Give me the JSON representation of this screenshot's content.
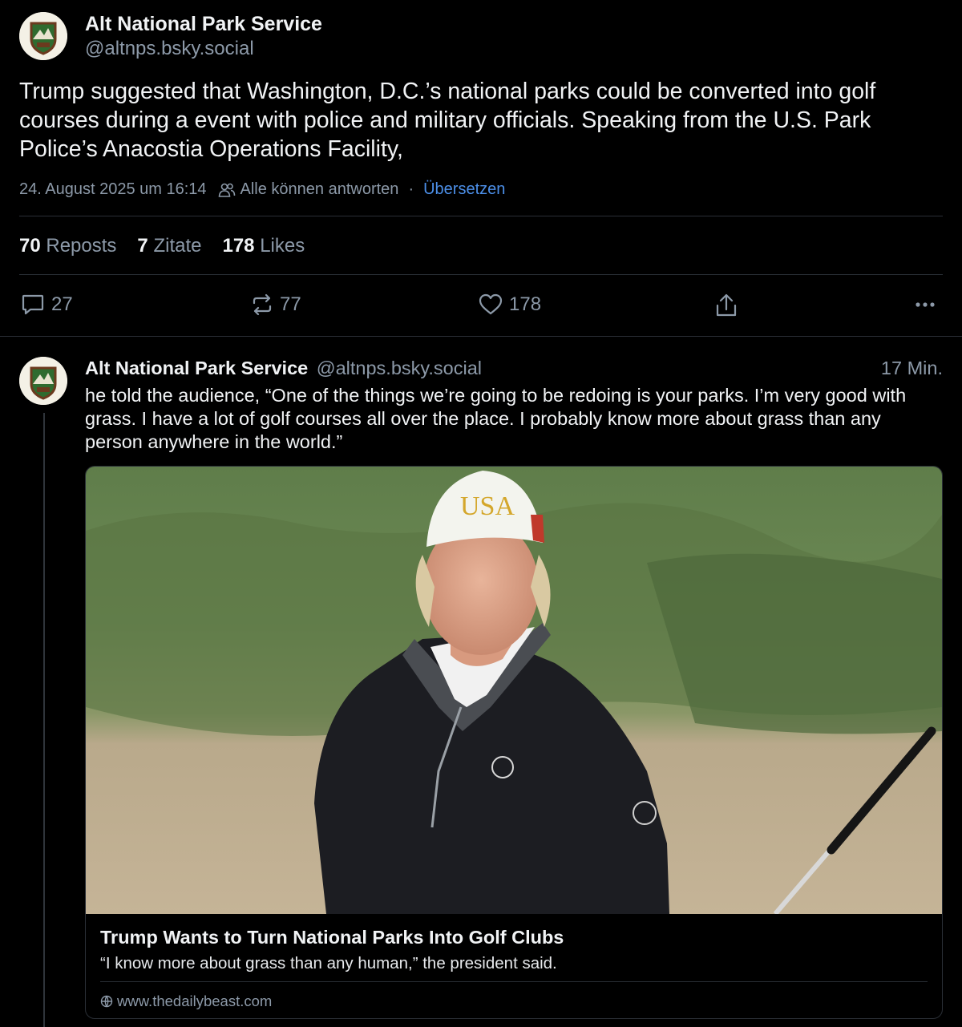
{
  "main_post": {
    "author_name": "Alt National Park Service",
    "author_handle": "@altnps.bsky.social",
    "text": "Trump suggested that Washington, D.C.’s national parks could be converted into golf courses during a event with police and military officials. Speaking from the U.S. Park Police’s Anacostia Operations Facility,",
    "timestamp": "24. August 2025 um 16:14",
    "reply_setting": "Alle können antworten",
    "separator": "·",
    "translate_label": "Übersetzen",
    "stats": {
      "reposts_count": "70",
      "reposts_label": "Reposts",
      "quotes_count": "7",
      "quotes_label": "Zitate",
      "likes_count": "178",
      "likes_label": "Likes"
    },
    "actions": {
      "reply_count": "27",
      "repost_count": "77",
      "like_count": "178"
    },
    "icons": [
      "people-icon",
      "reply-icon",
      "repost-icon",
      "heart-icon",
      "share-icon",
      "more-icon"
    ]
  },
  "reply_post": {
    "author_name": "Alt National Park Service",
    "author_handle": "@altnps.bsky.social",
    "time_ago": "17 Min.",
    "text": "he told the audience, “One of the things we’re going to be redoing is your parks. I’m very good with grass. I have a lot of golf courses all over the place. I probably know more about grass than any person anywhere in the world.”",
    "card": {
      "title": "Trump Wants to Turn National Parks Into Golf Clubs",
      "description": "“I know more about grass than any human,” the president said.",
      "domain": "www.thedailybeast.com",
      "cap_text": "USA"
    }
  },
  "colors": {
    "background": "#000000",
    "text": "#f1f3f5",
    "muted": "#8c99a8",
    "link": "#4c8fe8",
    "divider": "#2a2f36"
  }
}
